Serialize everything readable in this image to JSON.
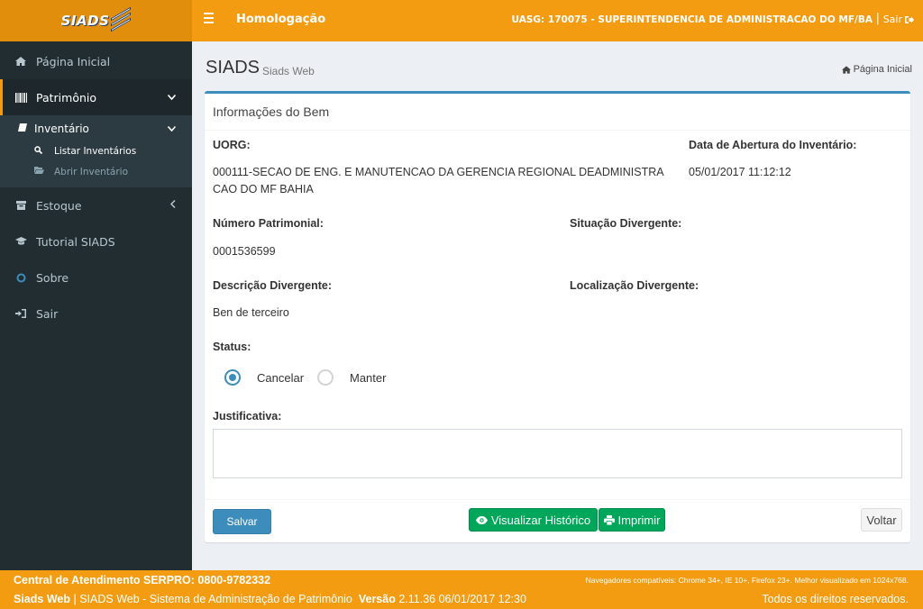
{
  "header": {
    "logo_text": "SIADS",
    "environment": "Homologação",
    "uasg": "UASG: 170075 - SUPERINTENDENCIA DE ADMINISTRACAO DO MF/BA",
    "separator": "|",
    "logout_label": "Sair"
  },
  "sidebar": {
    "items": [
      {
        "label": "Página Inicial",
        "icon": "home-icon"
      },
      {
        "label": "Patrimônio",
        "icon": "barcode-icon"
      },
      {
        "label": "Estoque",
        "icon": "box-icon"
      },
      {
        "label": "Tutorial SIADS",
        "icon": "graduation-cap-icon"
      },
      {
        "label": "Sobre",
        "icon": "circle-icon"
      },
      {
        "label": "Sair",
        "icon": "sign-in-icon"
      }
    ],
    "submenu": {
      "label": "Inventário",
      "children": [
        {
          "label": "Listar Inventários"
        },
        {
          "label": "Abrir Inventário"
        }
      ]
    }
  },
  "page": {
    "title": "SIADS",
    "subtitle": "Siads Web",
    "breadcrumb": "Página Inicial"
  },
  "form": {
    "box_title": "Informações do Bem",
    "uorg_label": "UORG:",
    "uorg_value_line1": "000111-SECAO DE ENG. E MANUTENCAO DA GERENCIA REGIONAL DEADMINISTRA",
    "uorg_value_line2": "CAO DO MF BAHIA",
    "data_abertura_label": "Data de Abertura do Inventário:",
    "data_abertura_value": "05/01/2017 11:12:12",
    "numero_label": "Número Patrimonial:",
    "numero_value": "0001536599",
    "situacao_label": "Situação Divergente:",
    "descricao_label": "Descrição Divergente:",
    "descricao_value": "Ben de terceiro",
    "localizacao_label": "Localização Divergente:",
    "status_label": "Status:",
    "status_options": [
      {
        "label": "Cancelar",
        "checked": true
      },
      {
        "label": "Manter",
        "checked": false
      }
    ],
    "justificativa_label": "Justificativa:",
    "justificativa_value": ""
  },
  "buttons": {
    "salvar": "Salvar",
    "historico": "Visualizar Histórico",
    "imprimir": "Imprimir",
    "voltar": "Voltar"
  },
  "footer": {
    "atendimento": "Central de Atendimento SERPRO: 0800-9782332",
    "navegadores": "Navegadores compatíveis: Chrome 34+, IE 10+, Firefox 23+. Melhor visualizado em 1024x768.",
    "app_name": "Siads Web",
    "app_desc": "SIADS Web - Sistema de Administração de Patrimônio",
    "versao_label": "Versão",
    "versao_value": "2.11.36 06/01/2017 12:30",
    "rights": "Todos os direitos reservados."
  },
  "colors": {
    "brand_orange": "#f39c12",
    "sidebar_dark": "#222d32",
    "primary_blue": "#3c8dbc",
    "success_green": "#00a65a"
  }
}
